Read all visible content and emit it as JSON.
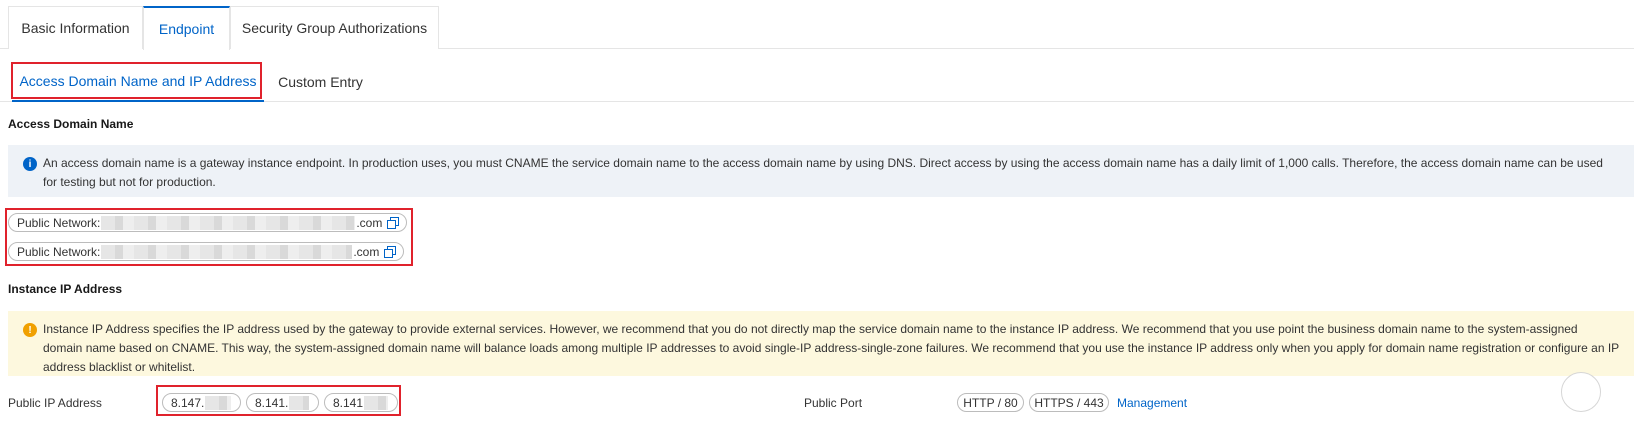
{
  "tabs": {
    "basic": "Basic Information",
    "endpoint": "Endpoint",
    "security": "Security Group Authorizations"
  },
  "subtabs": {
    "access": "Access Domain Name and IP Address",
    "custom": "Custom Entry"
  },
  "access_domain": {
    "title": "Access Domain Name",
    "notice": "An access domain name is a gateway instance endpoint. In production uses, you must CNAME the service domain name to the access domain name by using DNS. Direct access by using the access domain name has a daily limit of 1,000 calls. Therefore, the access domain name can be used for testing but not for production.",
    "entries": [
      {
        "label": "Public Network:",
        "suffix": ".com"
      },
      {
        "label": "Public Network:",
        "suffix": ".com"
      }
    ]
  },
  "instance_ip": {
    "title": "Instance IP Address",
    "notice": "Instance IP Address specifies the IP address used by the gateway to provide external services. However, we recommend that you do not directly map the service domain name to the instance IP address. We recommend that you use point the business domain name to the system-assigned domain name based on CNAME. This way, the system-assigned domain name will balance loads among multiple IP addresses to avoid single-IP address-single-zone failures. We recommend that you use the instance IP address only when you apply for domain name registration or configure an IP address blacklist or whitelist.",
    "public_ip_label": "Public IP Address",
    "ips": [
      "8.147.",
      "8.141.",
      "8.141"
    ],
    "public_port_label": "Public Port",
    "ports": [
      "HTTP / 80",
      "HTTPS / 443"
    ],
    "management": "Management"
  }
}
